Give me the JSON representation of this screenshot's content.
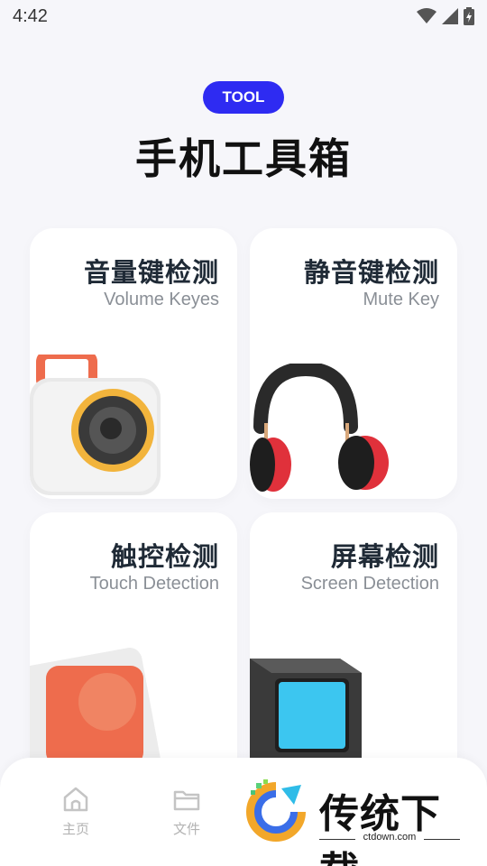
{
  "status_bar": {
    "time": "4:42"
  },
  "header": {
    "badge": "TOOL",
    "title": "手机工具箱"
  },
  "cards": [
    {
      "title": "音量键检测",
      "subtitle": "Volume Keyes",
      "icon": "speaker-icon"
    },
    {
      "title": "静音键检测",
      "subtitle": "Mute Key",
      "icon": "headphones-icon"
    },
    {
      "title": "触控检测",
      "subtitle": "Touch Detection",
      "icon": "button-icon"
    },
    {
      "title": "屏幕检测",
      "subtitle": "Screen Detection",
      "icon": "monitor-icon"
    }
  ],
  "bottom_nav": {
    "items": [
      {
        "label": "主页",
        "icon": "home-icon"
      },
      {
        "label": "文件",
        "icon": "folder-icon"
      }
    ]
  },
  "watermark": {
    "text": "传统下载",
    "url": "ctdown.com"
  },
  "colors": {
    "accent": "#2e2bf2",
    "background": "#f6f6fa",
    "card": "#ffffff"
  }
}
